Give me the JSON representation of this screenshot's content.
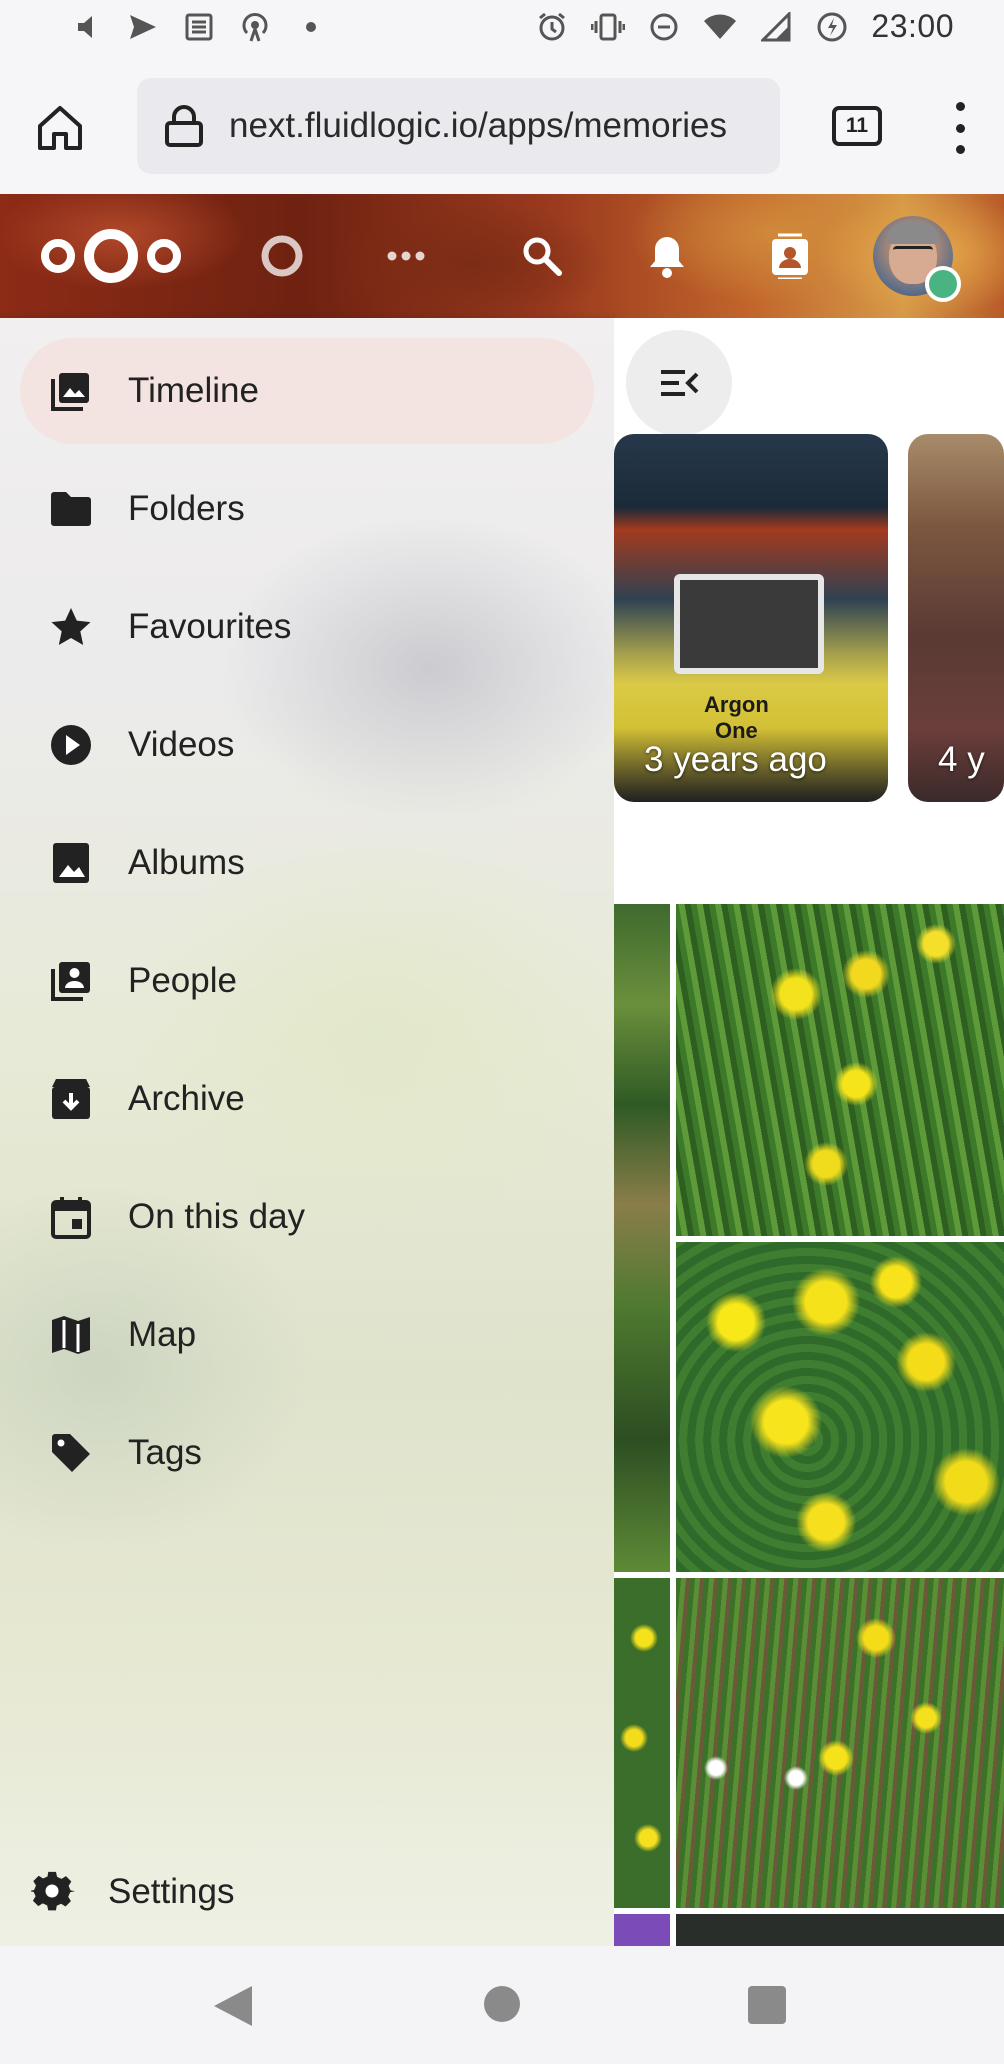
{
  "status_bar": {
    "time": "23:00",
    "left_icons": [
      "volume-icon",
      "send-icon",
      "list-icon",
      "hotspot-icon",
      "dot-icon"
    ],
    "right_icons": [
      "alarm-icon",
      "vibrate-icon",
      "dnd-icon",
      "wifi-icon",
      "signal-icon",
      "battery-saver-icon"
    ]
  },
  "browser": {
    "url": "next.fluidlogic.io/apps/memories",
    "tab_count": "11"
  },
  "header": {
    "icons": [
      "nextcloud-logo",
      "circle-app-icon",
      "more-apps-icon",
      "search-icon",
      "notifications-icon",
      "contacts-icon",
      "avatar"
    ],
    "status_color": "#49b382"
  },
  "nav": {
    "items": [
      {
        "label": "Timeline",
        "icon": "timeline-icon",
        "active": true
      },
      {
        "label": "Folders",
        "icon": "folder-icon"
      },
      {
        "label": "Favourites",
        "icon": "star-icon"
      },
      {
        "label": "Videos",
        "icon": "play-icon"
      },
      {
        "label": "Albums",
        "icon": "album-icon"
      },
      {
        "label": "People",
        "icon": "people-icon"
      },
      {
        "label": "Archive",
        "icon": "archive-icon"
      },
      {
        "label": "On this day",
        "icon": "calendar-icon"
      },
      {
        "label": "Map",
        "icon": "map-icon"
      },
      {
        "label": "Tags",
        "icon": "tag-icon"
      }
    ],
    "settings_label": "Settings",
    "active_color": "#f4e4e1"
  },
  "content": {
    "memories": [
      {
        "caption": "3 years ago",
        "label_line1": "Argon",
        "label_line2": "One"
      },
      {
        "caption": "4 y"
      }
    ]
  }
}
